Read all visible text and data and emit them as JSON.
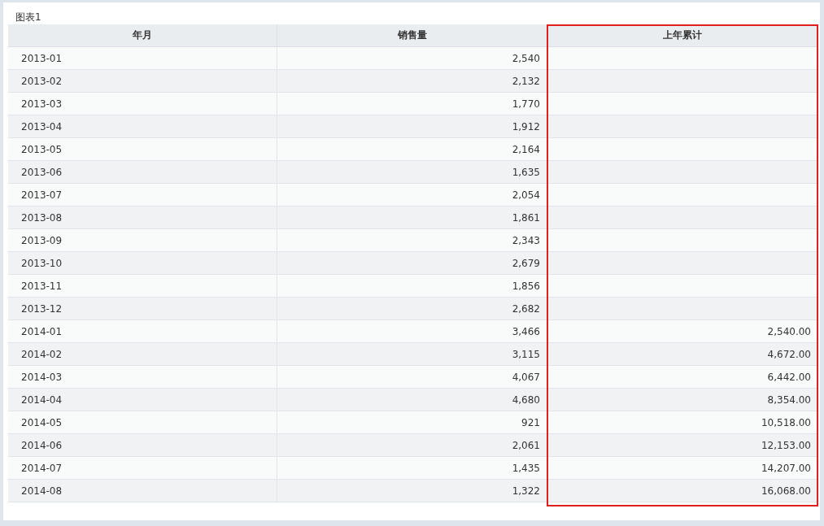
{
  "panel": {
    "title": "图表1"
  },
  "table": {
    "columns": [
      {
        "label": "年月",
        "kind": "text",
        "highlighted": false
      },
      {
        "label": "销售量",
        "kind": "number",
        "highlighted": false
      },
      {
        "label": "上年累计",
        "kind": "number",
        "highlighted": true
      }
    ],
    "rows": [
      [
        "2013-01",
        "2,540"
      ],
      [
        "2013-02",
        "2,132"
      ],
      [
        "2013-03",
        "1,770"
      ],
      [
        "2013-04",
        "1,912"
      ],
      [
        "2013-05",
        "2,164"
      ],
      [
        "2013-06",
        "1,635"
      ],
      [
        "2013-07",
        "2,054"
      ],
      [
        "2013-08",
        "1,861"
      ],
      [
        "2013-09",
        "2,343"
      ],
      [
        "2013-10",
        "2,679"
      ],
      [
        "2013-11",
        "1,856"
      ],
      [
        "2013-12",
        "2,682"
      ],
      [
        "2014-01",
        "3,466",
        "2,540.00"
      ],
      [
        "2014-02",
        "3,115",
        "4,672.00"
      ],
      [
        "2014-03",
        "4,067",
        "6,442.00"
      ],
      [
        "2014-04",
        "4,680",
        "8,354.00"
      ],
      [
        "2014-05",
        "921",
        "10,518.00"
      ],
      [
        "2014-06",
        "2,061",
        "12,153.00"
      ],
      [
        "2014-07",
        "1,435",
        "14,207.00"
      ],
      [
        "2014-08",
        "1,322",
        "16,068.00"
      ]
    ]
  }
}
